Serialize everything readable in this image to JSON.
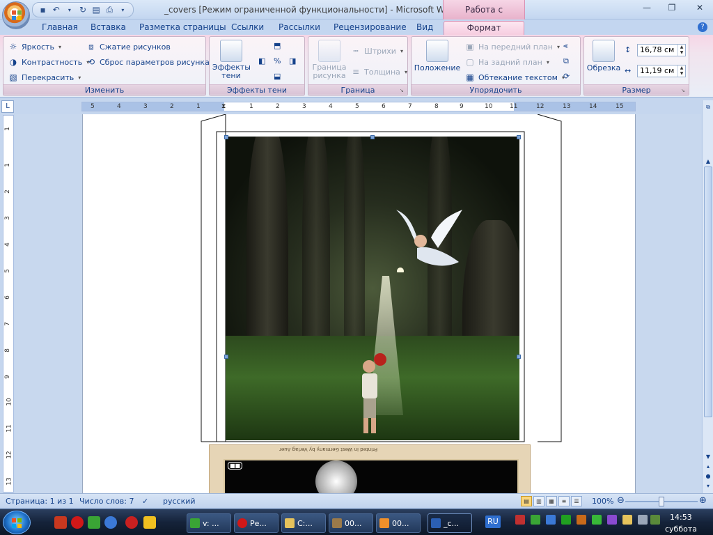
{
  "window": {
    "title": "_covers [Режим ограниченной функциональности] - Microsoft Word",
    "tools_tab_title": "Работа с рисунками"
  },
  "qat": {
    "icons": [
      "save-icon",
      "undo-icon",
      "redo-icon",
      "print-preview-icon",
      "print-icon"
    ]
  },
  "tabs": [
    {
      "label": "Главная"
    },
    {
      "label": "Вставка"
    },
    {
      "label": "Разметка страницы"
    },
    {
      "label": "Ссылки"
    },
    {
      "label": "Рассылки"
    },
    {
      "label": "Рецензирование"
    },
    {
      "label": "Вид"
    },
    {
      "label": "Формат",
      "active": true
    }
  ],
  "ribbon": {
    "adjust": {
      "label": "Изменить",
      "brightness": "Яркость",
      "contrast": "Контрастность",
      "recolor": "Перекрасить",
      "compress": "Сжатие рисунков",
      "reset": "Сброс параметров рисунка"
    },
    "shadow": {
      "label": "Эффекты тени",
      "button": "Эффекты тени"
    },
    "border": {
      "label": "Граница",
      "picture_border": "Граница рисунка",
      "dashes": "Штрихи",
      "weight": "Толщина"
    },
    "arrange": {
      "label": "Упорядочить",
      "position": "Положение",
      "bring_front": "На передний план",
      "send_back": "На задний план",
      "text_wrap": "Обтекание текстом"
    },
    "size": {
      "label": "Размер",
      "crop": "Обрезка",
      "height": "16,78 см",
      "width": "11,19 см"
    }
  },
  "ruler": {
    "h_ticks": [
      "5",
      "4",
      "3",
      "2",
      "1",
      "1",
      "2",
      "3",
      "4",
      "5",
      "6",
      "7",
      "8",
      "9",
      "10",
      "11",
      "12",
      "13",
      "14",
      "15"
    ],
    "v_ticks": [
      "1",
      "1",
      "2",
      "3",
      "4",
      "5",
      "6",
      "7",
      "8",
      "9",
      "10",
      "11",
      "12",
      "13"
    ]
  },
  "document": {
    "second_caption": "Printed in West Germany by Verlag Auer",
    "second_badge": "■■"
  },
  "statusbar": {
    "page": "Страница: 1 из 1",
    "words": "Число слов: 7",
    "language": "русский",
    "zoom": "100%"
  },
  "taskbar": {
    "tasks": [
      {
        "label": "v: ..."
      },
      {
        "label": "Ре..."
      },
      {
        "label": "C:..."
      },
      {
        "label": "00..."
      },
      {
        "label": "00..."
      },
      {
        "label": "_c...",
        "active": true
      }
    ],
    "lang": "RU",
    "time": "14:53",
    "day": "суббота"
  },
  "colors": {
    "accent": "#15428b",
    "tools_tab": "#e8b2cb",
    "taskbar": "#15233a"
  }
}
